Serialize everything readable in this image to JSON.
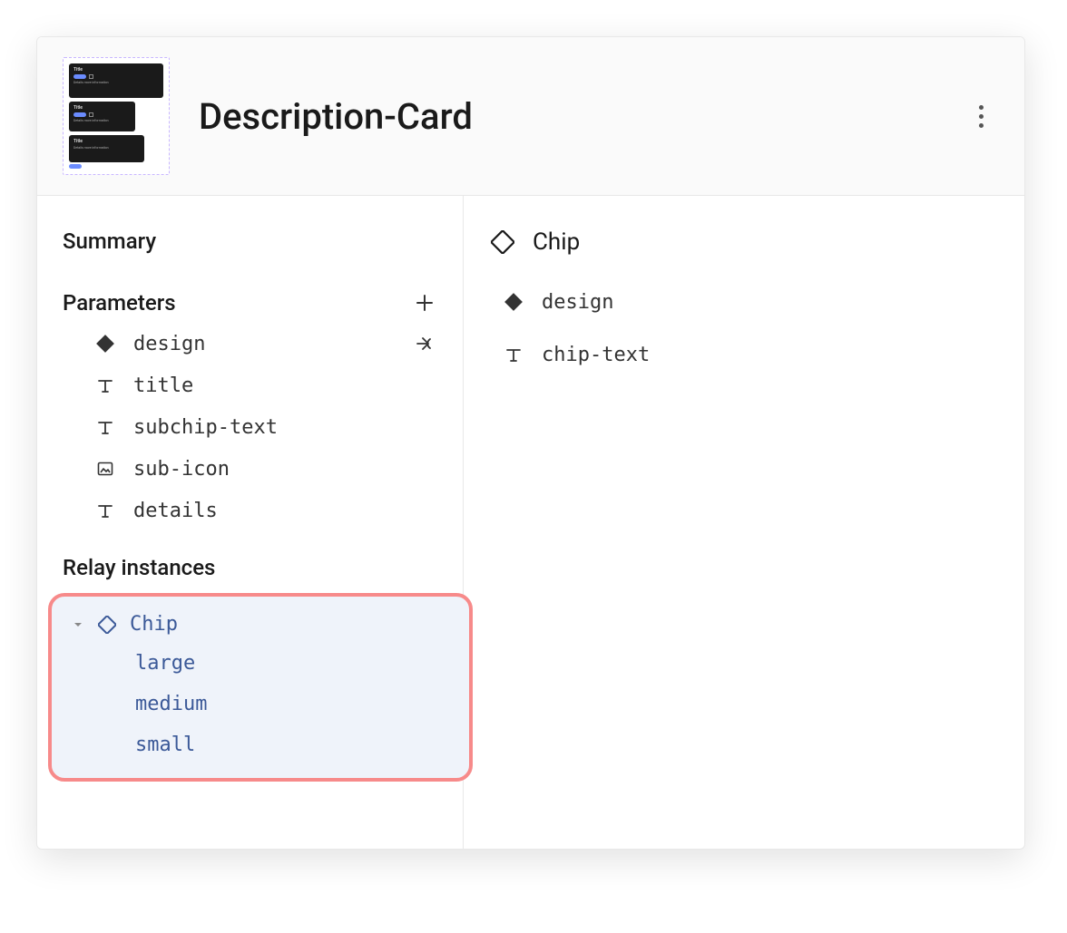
{
  "header": {
    "title": "Description-Card",
    "thumbnail_label": "Title"
  },
  "left": {
    "summary_label": "Summary",
    "parameters_label": "Parameters",
    "parameters": [
      {
        "name": "design",
        "icon": "diamond-filled"
      },
      {
        "name": "title",
        "icon": "text"
      },
      {
        "name": "subchip-text",
        "icon": "text"
      },
      {
        "name": "sub-icon",
        "icon": "image"
      },
      {
        "name": "details",
        "icon": "text"
      }
    ],
    "relay_instances_label": "Relay instances",
    "instance": {
      "name": "Chip",
      "variants": [
        "large",
        "medium",
        "small"
      ]
    }
  },
  "right": {
    "component_name": "Chip",
    "params": [
      {
        "name": "design",
        "icon": "diamond-filled"
      },
      {
        "name": "chip-text",
        "icon": "text"
      }
    ]
  }
}
